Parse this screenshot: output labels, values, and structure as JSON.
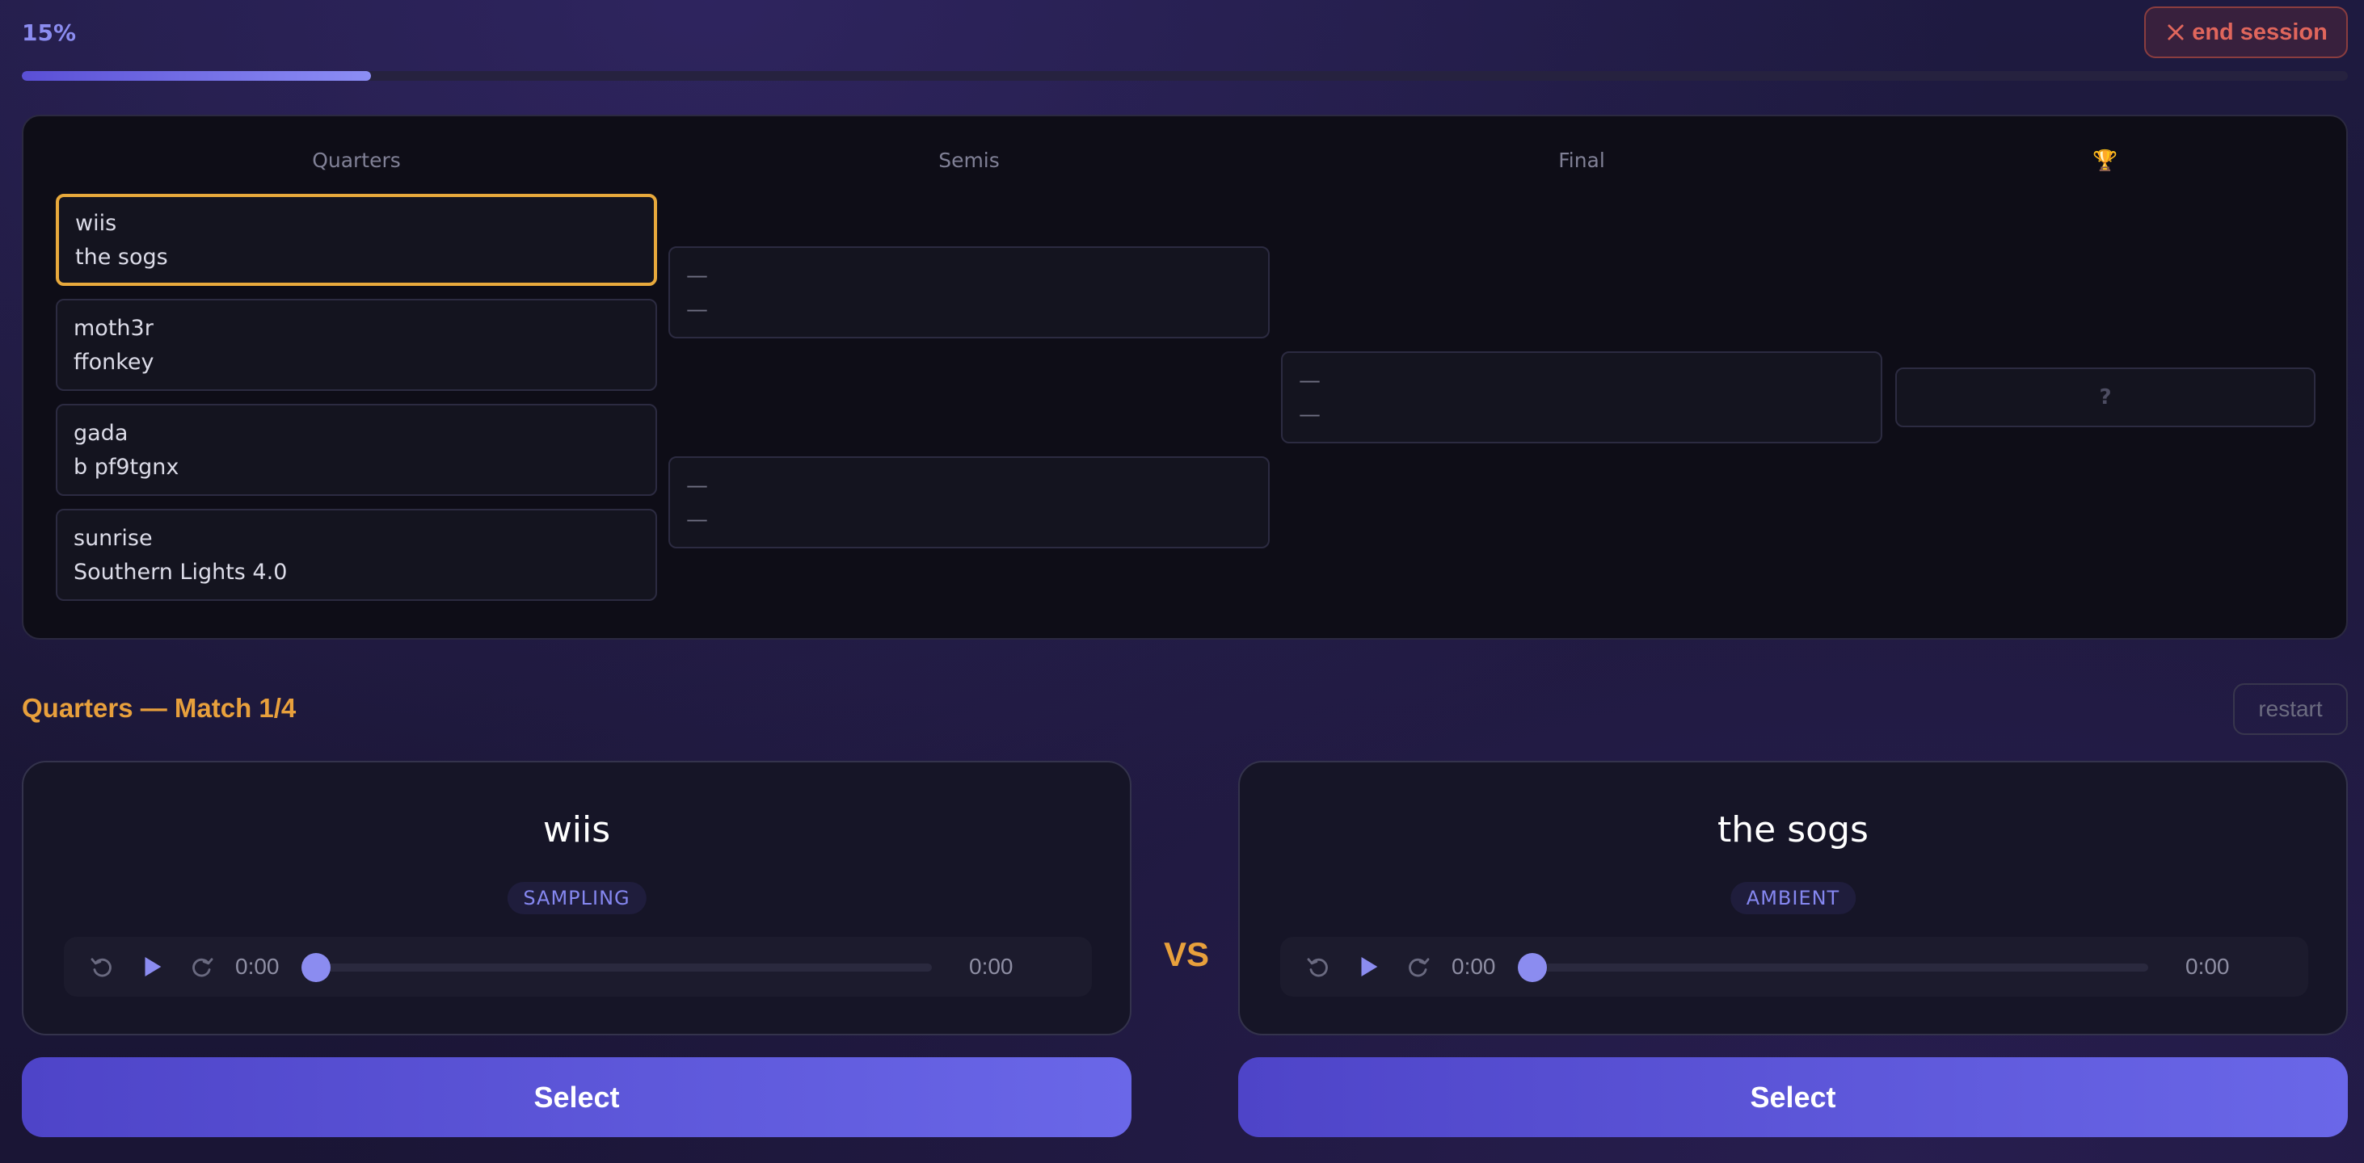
{
  "progress": {
    "label": "15%",
    "fraction": 0.15
  },
  "header": {
    "end_session_label": "end session"
  },
  "bracket": {
    "rounds": [
      "Quarters",
      "Semis",
      "Final"
    ],
    "trophy_icon": "trophy-icon",
    "trophy_glyph": "🏆",
    "quarters": [
      {
        "a": "wiis",
        "b": "the sogs",
        "active": true
      },
      {
        "a": "moth3r",
        "b": "ffonkey",
        "active": false
      },
      {
        "a": "gada",
        "b": "b pf9tgnx",
        "active": false
      },
      {
        "a": "sunrise",
        "b": "Southern Lights 4.0",
        "active": false
      }
    ],
    "semis": [
      {
        "a": "—",
        "b": "—"
      },
      {
        "a": "—",
        "b": "—"
      }
    ],
    "final": {
      "a": "—",
      "b": "—"
    },
    "champion": "?"
  },
  "match": {
    "title": "Quarters — Match 1/4",
    "restart_label": "restart",
    "vs_label": "VS",
    "left": {
      "name": "wiis",
      "genre": "SAMPLING",
      "current_time": "0:00",
      "duration": "0:00",
      "select_label": "Select"
    },
    "right": {
      "name": "the sogs",
      "genre": "AMBIENT",
      "current_time": "0:00",
      "duration": "0:00",
      "select_label": "Select"
    }
  },
  "colors": {
    "accent": "#8b8cf0",
    "highlight": "#e8a93c",
    "danger": "#e0665c",
    "button": "#5a52d6"
  }
}
